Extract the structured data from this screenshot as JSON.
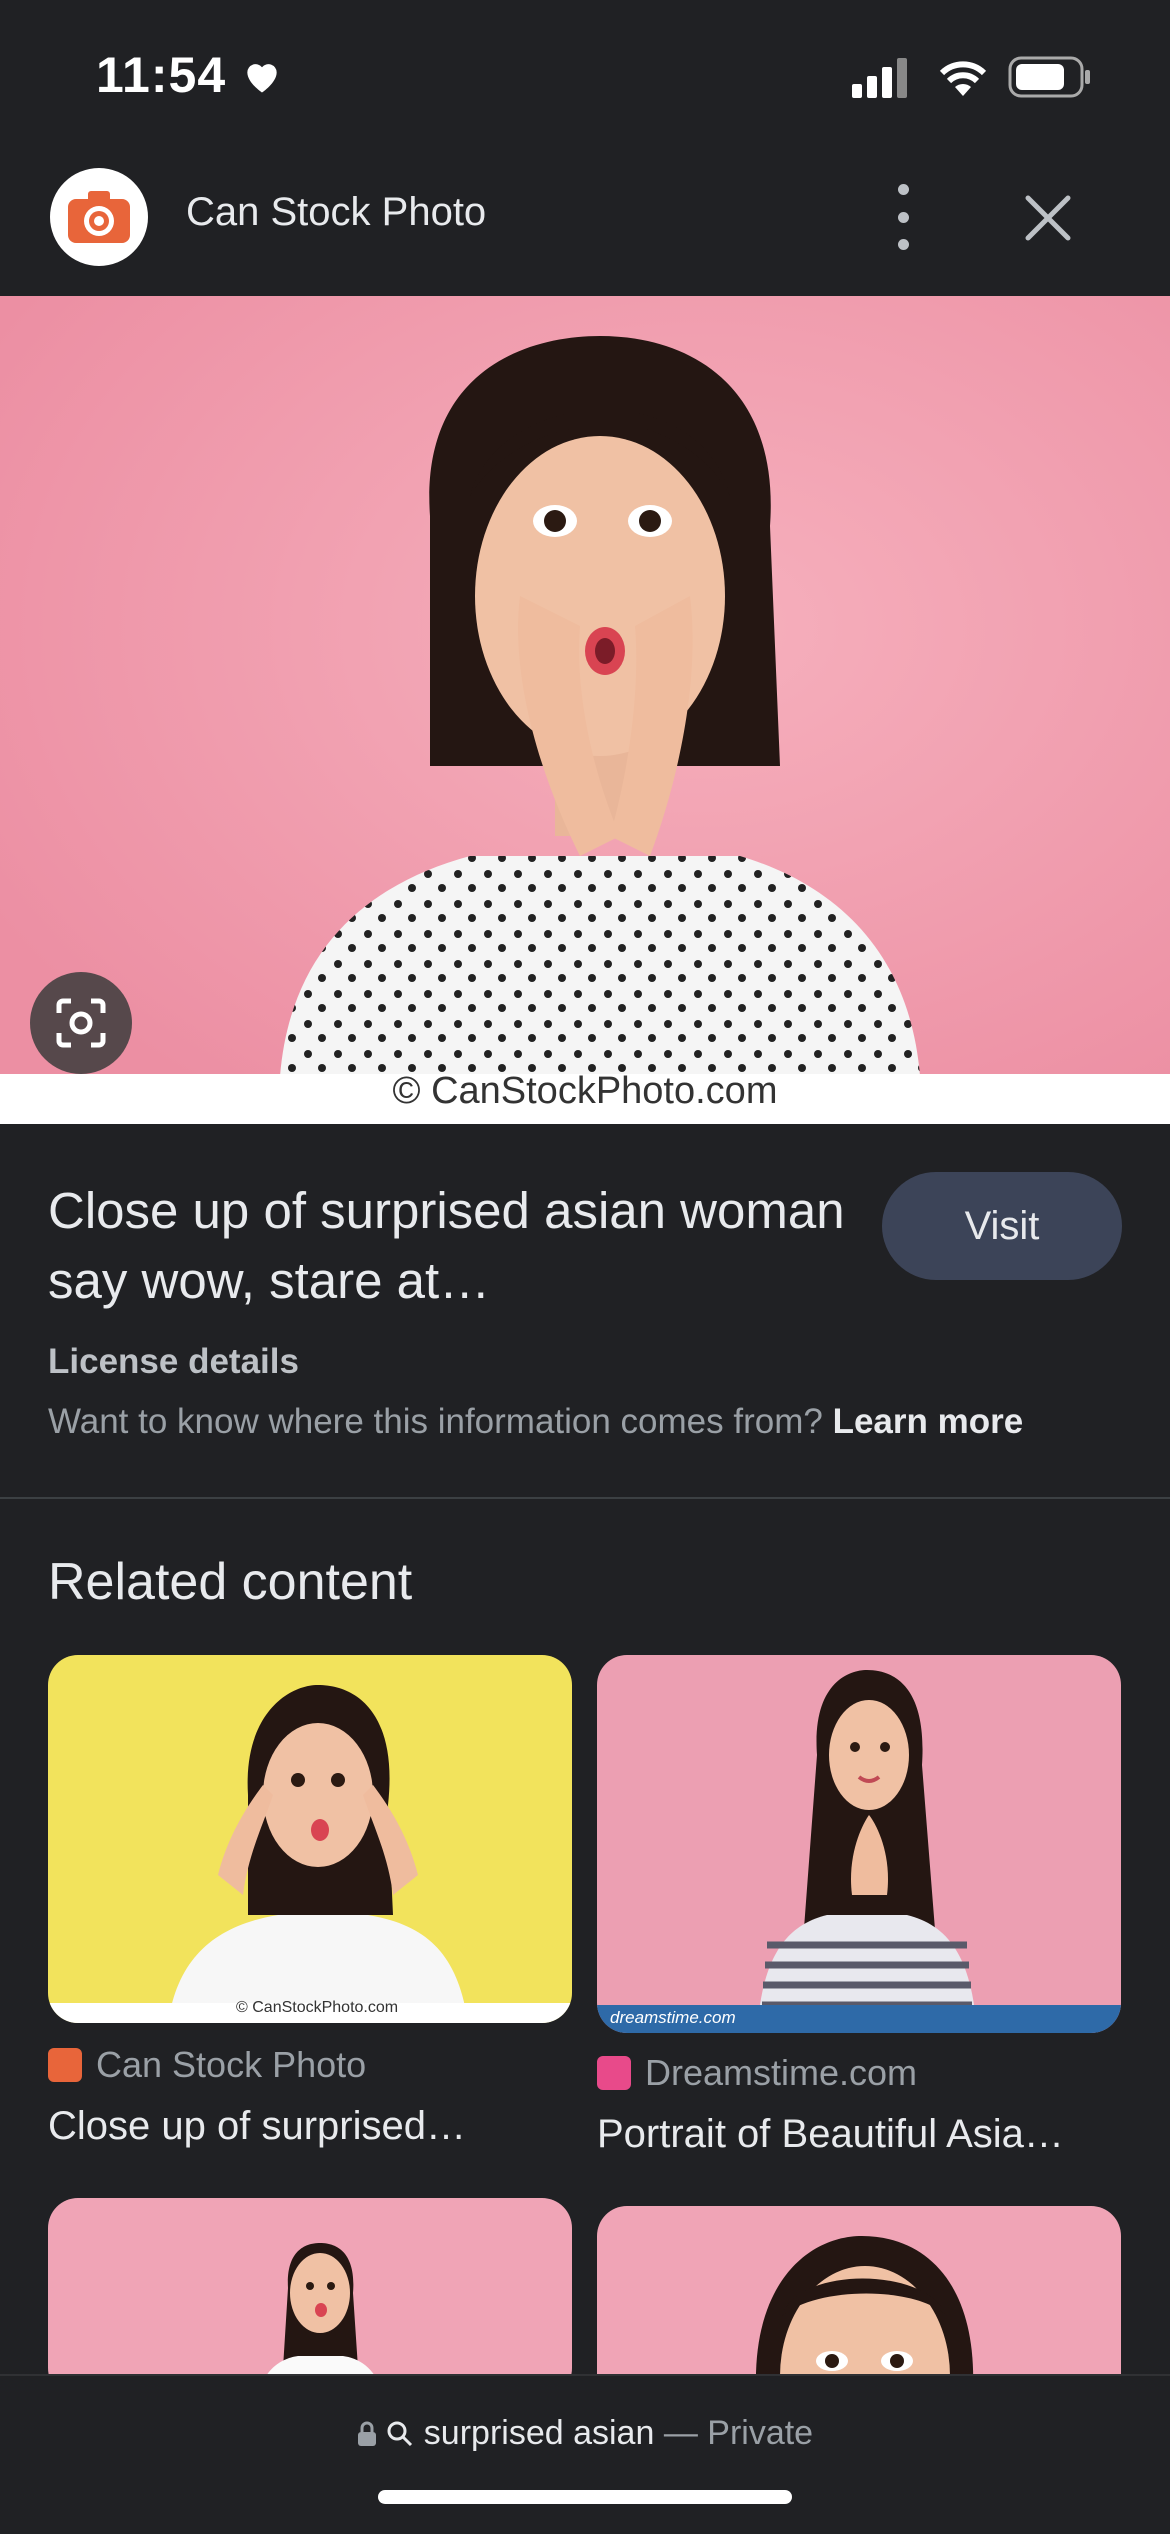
{
  "status": {
    "time": "11:54"
  },
  "header": {
    "site_name": "Can Stock Photo"
  },
  "image": {
    "watermark": "© CanStockPhoto.com"
  },
  "info": {
    "title": "Close up of surprised asian woman say wow, stare at…",
    "visit_label": "Visit",
    "license": "License details",
    "info_text": "Want to know where this information comes from?",
    "learn_more": "Learn more"
  },
  "related": {
    "heading": "Related content",
    "items": [
      {
        "source": "Can Stock Photo",
        "title": "Close up of surprised…",
        "watermark": "© CanStockPhoto.com"
      },
      {
        "source": "Dreamstime.com",
        "title": "Portrait of Beautiful Asia…",
        "watermark": "dreamstime.com"
      }
    ]
  },
  "bottom": {
    "query": "surprised asian",
    "separator": "—",
    "mode": "Private"
  },
  "colors": {
    "background": "#202124",
    "visit_button": "#3c4458",
    "brand_orange": "#e8653a",
    "pink": "#f3a4b4",
    "yellow": "#f2e35c"
  }
}
